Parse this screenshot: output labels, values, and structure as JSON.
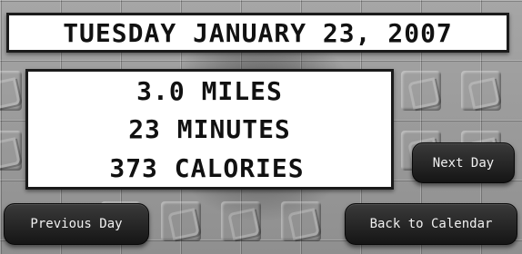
{
  "header": {
    "date": "TUESDAY JANUARY 23, 2007"
  },
  "stats": {
    "distance": "3.0 MILES",
    "duration": "23 MINUTES",
    "calories": "373 CALORIES"
  },
  "buttons": {
    "next_day": "Next Day",
    "previous_day": "Previous Day",
    "back_to_calendar": "Back to Calendar"
  },
  "background": {
    "pattern_icon": "embossed-tile-icon"
  }
}
